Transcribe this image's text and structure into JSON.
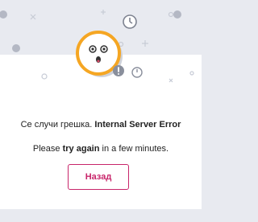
{
  "page": {
    "error_prefix": "Се случи грешка.",
    "error_title": "Internal Server Error",
    "retry_prefix": "Please",
    "retry_emphasis": "try again",
    "retry_suffix": "in a few minutes.",
    "back_button_label": "Назад"
  },
  "icons": {
    "mascot": "surprised-face-icon",
    "clock": "clock-icon",
    "alert": "exclamation-circle-icon"
  },
  "colors": {
    "accent": "#c8256a",
    "mascot_ring": "#f5a623",
    "background": "#e8eaf0",
    "card": "#ffffff"
  }
}
